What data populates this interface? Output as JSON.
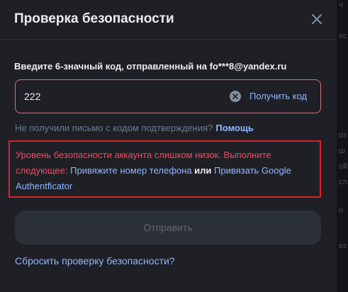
{
  "modal": {
    "title": "Проверка безопасности",
    "label": "Введите 6-значный код, отправленный на fo***8@yandex.ru",
    "input_value": "222",
    "get_code_label": "Получить код",
    "hint_text": "Не получили письмо с кодом подтверждения?",
    "help_link": "Помощь",
    "alert": {
      "text": "Уровень безопасности аккаунта слишком низок. Выполните следующее:",
      "link_phone": "Привяжите номер телефона",
      "or_text": "или",
      "link_google": "Привязать Google Authentficator"
    },
    "submit_label": "Отправить",
    "reset_link": "Сбросить проверку безопасности?"
  },
  "colors": {
    "accent_link": "#8fb6ff",
    "error": "#f6465d",
    "alert_border": "#e0202a",
    "modal_bg": "#1e2026"
  }
}
